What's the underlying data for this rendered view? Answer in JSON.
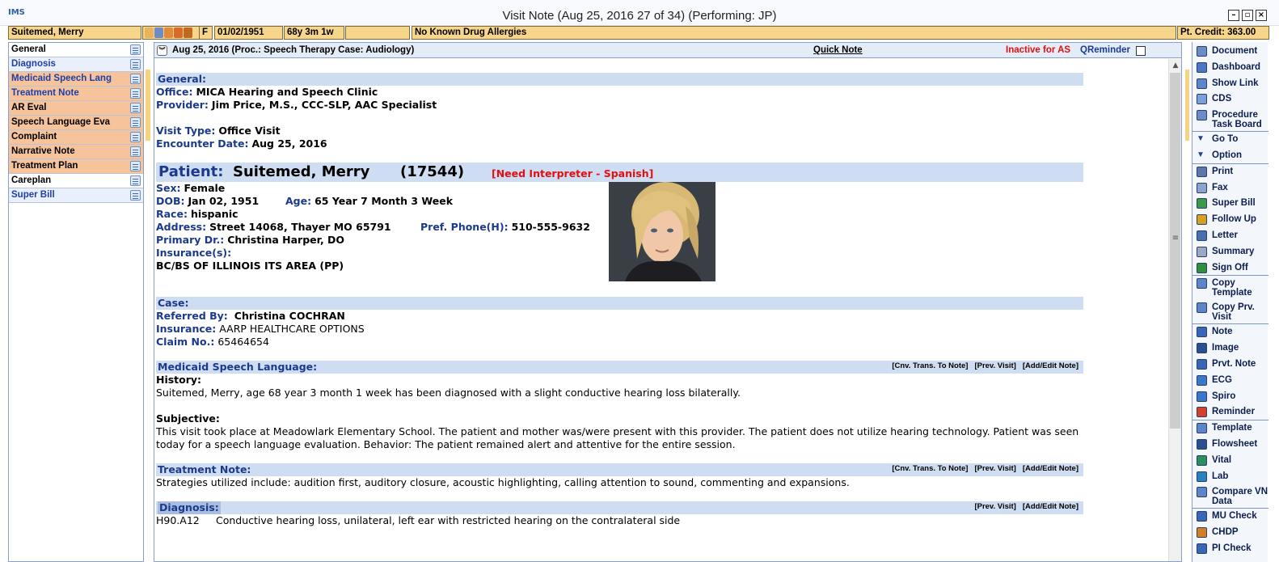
{
  "window": {
    "title": "Visit Note (Aug 25, 2016   27 of 34) (Performing: JP)",
    "app_icon": "IMS"
  },
  "banner": {
    "patient_name": "Suitemed, Merry",
    "sex": "F",
    "dob": "01/02/1951",
    "age": "68y 3m 1w",
    "allergies": "No Known Drug Allergies",
    "credit": "Pt. Credit: 363.00"
  },
  "sidebar": {
    "items": [
      {
        "label": "General",
        "color": "#000000",
        "bg": "#ffffff"
      },
      {
        "label": "Diagnosis",
        "color": "#1f3fa8",
        "bg": "#e9f0fb"
      },
      {
        "label": "Medicaid Speech Lang",
        "color": "#1f3fa8",
        "bg": "#f6c39b"
      },
      {
        "label": "Treatment Note",
        "color": "#1f3fa8",
        "bg": "#f6c39b"
      },
      {
        "label": "AR Eval",
        "color": "#000000",
        "bg": "#f6c39b"
      },
      {
        "label": "Speech Language Eva",
        "color": "#000000",
        "bg": "#f6c39b"
      },
      {
        "label": "Complaint",
        "color": "#000000",
        "bg": "#f6c39b"
      },
      {
        "label": "Narrative Note",
        "color": "#000000",
        "bg": "#f6c39b"
      },
      {
        "label": "Treatment Plan",
        "color": "#000000",
        "bg": "#f6c39b"
      },
      {
        "label": "Careplan",
        "color": "#000000",
        "bg": "#ffffff"
      },
      {
        "label": "Super Bill",
        "color": "#1f3fa8",
        "bg": "#e9f0fb"
      }
    ]
  },
  "header": {
    "visit_info": "Aug 25, 2016  (Proc.: Speech Therapy  Case: Audiology)",
    "quick_note": "Quick Note",
    "inactive": "Inactive for AS",
    "qreminder": "QReminder"
  },
  "note": {
    "general": {
      "title": "General:",
      "office_label": "Office:",
      "office": "MICA Hearing and Speech Clinic",
      "provider_label": "Provider:",
      "provider": "Jim Price, M.S., CCC-SLP, AAC Specialist",
      "visit_type_label": "Visit Type:",
      "visit_type": "Office Visit",
      "encounter_label": "Encounter Date:",
      "encounter": "Aug 25, 2016"
    },
    "patient": {
      "title_label": "Patient:",
      "title_name": "Suitemed, Merry",
      "title_id": "(17544)",
      "interpreter": "[Need Interpreter - Spanish]",
      "sex_label": "Sex:",
      "sex": "Female",
      "dob_label": "DOB:",
      "dob": "Jan 02, 1951",
      "age_label": "Age:",
      "age": "65 Year 7 Month 3 Week",
      "race_label": "Race:",
      "race": "hispanic",
      "address_label": "Address:",
      "address": "Street 14068, Thayer MO 65791",
      "phone_label": "Pref. Phone(H):",
      "phone": "510-555-9632",
      "primary_label": "Primary Dr.:",
      "primary": "Christina Harper, DO",
      "insurance_label": "Insurance(s):",
      "insurance": "BC/BS OF ILLINOIS ITS AREA (PP)"
    },
    "case": {
      "title": "Case:",
      "referred_label": "Referred By:",
      "referred": "Christina COCHRAN",
      "insurance_label": "Insurance:",
      "insurance": "AARP HEALTHCARE OPTIONS",
      "claim_label": "Claim No.:",
      "claim": "65464654"
    },
    "medicaid": {
      "title": "Medicaid Speech Language:",
      "links": [
        "[Cnv. Trans. To Note]",
        "[Prev. Visit]",
        "[Add/Edit Note]"
      ],
      "history_label": "History:",
      "history": "Suitemed, Merry, age 68 year 3 month 1 week has been diagnosed with a slight conductive hearing loss bilaterally.",
      "subjective_label": "Subjective:",
      "subjective": "This visit took place at Meadowlark Elementary School. The patient and mother was/were present with this provider. The patient does not utilize hearing technology. Patient was seen today for a speech language evaluation. Behavior: The patient remained alert and attentive for the entire session."
    },
    "treatment": {
      "title": "Treatment Note:",
      "links": [
        "[Cnv. Trans. To Note]",
        "[Prev. Visit]",
        "[Add/Edit Note]"
      ],
      "text": "Strategies utilized include: audition first, auditory closure, acoustic highlighting, calling attention to sound, commenting and expansions."
    },
    "diagnosis": {
      "title": "Diagnosis:",
      "links": [
        "[Prev. Visit]",
        "[Add/Edit Note]"
      ],
      "code": "H90.A12",
      "text": "Conductive hearing loss, unilateral, left ear with restricted hearing on the contralateral side"
    }
  },
  "toolbar": {
    "items": [
      {
        "label": "Document",
        "icon": "document-icon",
        "color": "#6b8cc8"
      },
      {
        "label": "Dashboard",
        "icon": "dashboard-icon",
        "color": "#4a76c2"
      },
      {
        "label": "Show Link",
        "icon": "link-icon",
        "color": "#5b86c9"
      },
      {
        "label": "CDS",
        "icon": "cds-icon",
        "color": "#7aa0d8"
      },
      {
        "label": "Procedure Task Board",
        "icon": "task-board-icon",
        "color": "#6b8cc8"
      },
      {
        "label": "Go To",
        "icon": "triangle-down-icon",
        "color": "#1c3f8f"
      },
      {
        "label": "Option",
        "icon": "triangle-down-icon",
        "color": "#1c3f8f"
      },
      {
        "label": "Print",
        "icon": "print-icon",
        "color": "#5b78a8"
      },
      {
        "label": "Fax",
        "icon": "fax-icon",
        "color": "#8aa3cf"
      },
      {
        "label": "Super Bill",
        "icon": "super-bill-icon",
        "color": "#3a9a4a"
      },
      {
        "label": "Follow Up",
        "icon": "follow-up-icon",
        "color": "#d8a020"
      },
      {
        "label": "Letter",
        "icon": "letter-icon",
        "color": "#4a6fb0"
      },
      {
        "label": "Summary",
        "icon": "summary-icon",
        "color": "#9aa9c2"
      },
      {
        "label": "Sign Off",
        "icon": "sign-off-icon",
        "color": "#2f8f3a"
      },
      {
        "label": "Copy Template",
        "icon": "copy-template-icon",
        "color": "#5b86c9"
      },
      {
        "label": "Copy Prv. Visit",
        "icon": "copy-visit-icon",
        "color": "#5b86c9"
      },
      {
        "label": "Note",
        "icon": "note-icon",
        "color": "#3a66b8"
      },
      {
        "label": "Image",
        "icon": "image-icon",
        "color": "#2a4f8f"
      },
      {
        "label": "Prvt. Note",
        "icon": "private-note-icon",
        "color": "#3a66b8"
      },
      {
        "label": "ECG",
        "icon": "ecg-icon",
        "color": "#3b78c9"
      },
      {
        "label": "Spiro",
        "icon": "spiro-icon",
        "color": "#3b78c9"
      },
      {
        "label": "Reminder",
        "icon": "reminder-icon",
        "color": "#d4402a"
      },
      {
        "label": "Template",
        "icon": "template-icon",
        "color": "#5b86c9"
      },
      {
        "label": "Flowsheet",
        "icon": "flowsheet-icon",
        "color": "#2a4f8f"
      },
      {
        "label": "Vital",
        "icon": "vital-icon",
        "color": "#2a8f5a"
      },
      {
        "label": "Lab",
        "icon": "lab-icon",
        "color": "#2a7fbf"
      },
      {
        "label": "Compare VN Data",
        "icon": "compare-icon",
        "color": "#5b86c9"
      },
      {
        "label": "MU Check",
        "icon": "mu-check-icon",
        "color": "#3a66b8"
      },
      {
        "label": "CHDP",
        "icon": "chdp-icon",
        "color": "#d08020"
      },
      {
        "label": "PI Check",
        "icon": "pi-check-icon",
        "color": "#3a66b8"
      }
    ]
  }
}
